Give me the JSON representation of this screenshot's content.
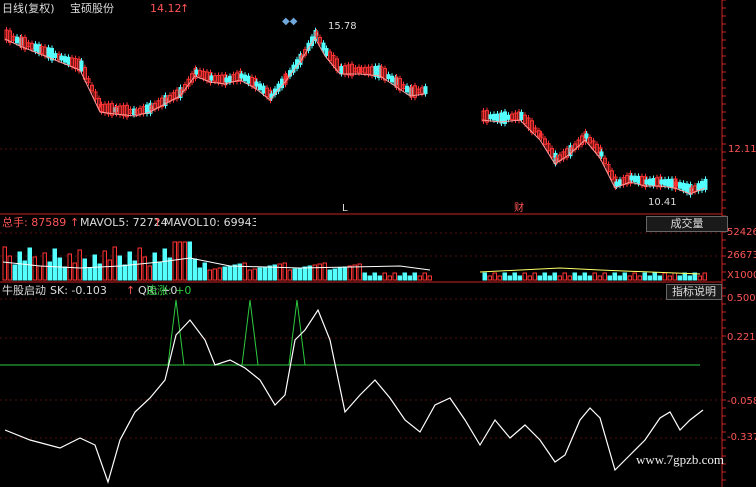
{
  "header": {
    "period_label": "日线(复权)",
    "stock_name": "宝硕股份",
    "price": "14.12",
    "price_arrow": "↑"
  },
  "price_panel": {
    "high_label": "15.78",
    "low_label": "10.41",
    "right_axis_label": "12.11",
    "marker_l": "L",
    "marker_cai": "财"
  },
  "volume_panel": {
    "total_label": "总手: 87589",
    "mavol5_label": "MAVOL5: 72724",
    "mavol10_label": "MAVOL10: 69943",
    "axis_labels": [
      "52426",
      "26673",
      "X1000"
    ],
    "button_label": "成交量"
  },
  "indicator_panel": {
    "name_label": "牛股启动",
    "sk_label": "SK: -0.103",
    "qr_label": "QR: +0",
    "zz_label": "追涨: +0",
    "axis_labels": [
      "0.500",
      "0.221",
      "-0.058",
      "-0.337"
    ],
    "button_label": "指标说明"
  },
  "watermark": "www.7gpzb.com",
  "colors": {
    "up": "#ff3333",
    "down": "#54ffff",
    "ma": "#ffffff",
    "signal": "#2ecc40",
    "axis": "#cc2222"
  }
}
